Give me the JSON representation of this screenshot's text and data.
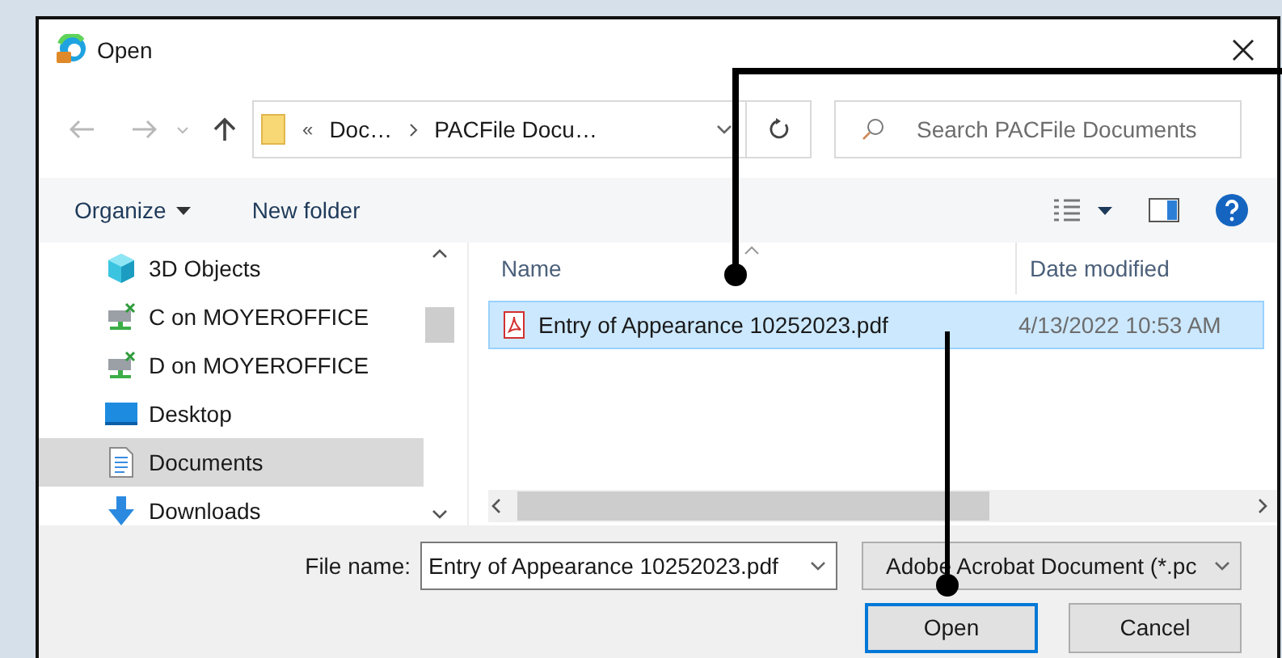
{
  "window": {
    "title": "Open"
  },
  "navigation": {
    "back_disabled": true,
    "forward_disabled": true
  },
  "address_bar": {
    "overflow": "«",
    "crumbs": [
      "Doc…",
      "PACFile Docu…"
    ]
  },
  "search": {
    "placeholder": "Search PACFile Documents"
  },
  "toolbar": {
    "organize": "Organize",
    "new_folder": "New folder"
  },
  "sidebar": {
    "items": [
      {
        "label": "3D Objects",
        "kind": "cube",
        "selected": false
      },
      {
        "label": "C on MOYEROFFICE",
        "kind": "drive",
        "selected": false
      },
      {
        "label": "D on MOYEROFFICE",
        "kind": "drive",
        "selected": false
      },
      {
        "label": "Desktop",
        "kind": "desktop",
        "selected": false
      },
      {
        "label": "Documents",
        "kind": "documents",
        "selected": true
      },
      {
        "label": "Downloads",
        "kind": "downloads",
        "selected": false
      }
    ]
  },
  "table": {
    "columns": [
      "Name",
      "Date modified"
    ],
    "rows": [
      {
        "name": "Entry of Appearance 10252023.pdf",
        "date": "4/13/2022 10:53 AM",
        "selected": true
      }
    ]
  },
  "file_name": {
    "label": "File name:",
    "value": "Entry of Appearance 10252023.pdf"
  },
  "file_type": {
    "value": "Adobe Acrobat Document (*.pc"
  },
  "buttons": [
    {
      "label": "Open",
      "default": true
    },
    {
      "label": "Cancel",
      "default": false
    }
  ]
}
